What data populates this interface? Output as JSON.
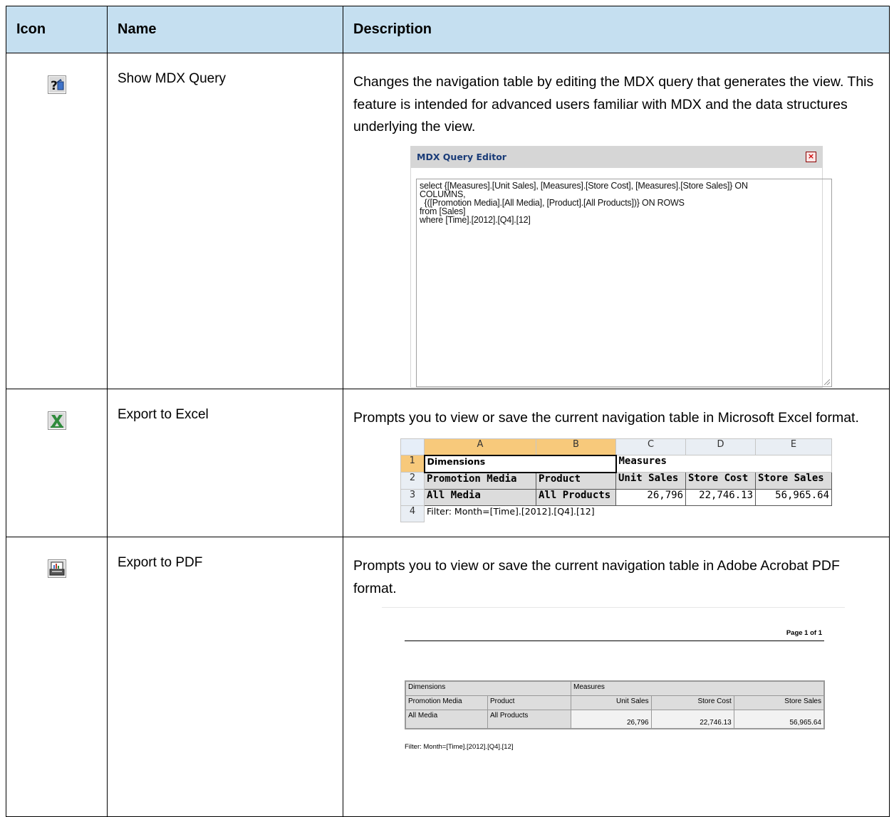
{
  "headers": {
    "icon": "Icon",
    "name": "Name",
    "description": "Description"
  },
  "rows": [
    {
      "icon": "mdx-query-icon",
      "name": "Show MDX Query",
      "description": "Changes the navigation table by editing the MDX query that generates the view. This feature is intended for advanced users familiar with MDX and the data structures underlying the view."
    },
    {
      "icon": "excel-export-icon",
      "name": "Export to Excel",
      "description": "Prompts you to view or save the current navigation table in Microsoft Excel format."
    },
    {
      "icon": "pdf-export-icon",
      "name": "Export to PDF",
      "description": "Prompts you to view or save the current navigation table in Adobe Acrobat PDF format."
    }
  ],
  "mdx_editor": {
    "title": "MDX Query Editor",
    "close_glyph": "×",
    "query": "select {[Measures].[Unit Sales], [Measures].[Store Cost], [Measures].[Store Sales]} ON\nCOLUMNS,\n  {([Promotion Media].[All Media], [Product].[All Products])} ON ROWS\nfrom [Sales]\nwhere [Time].[2012].[Q4].[12]"
  },
  "excel_preview": {
    "columns": [
      "A",
      "B",
      "C",
      "D",
      "E"
    ],
    "row_numbers": [
      "1",
      "2",
      "3",
      "4"
    ],
    "dimensions": "Dimensions",
    "measures": "Measures",
    "headers": [
      "Promotion Media",
      "Product",
      "Unit Sales",
      "Store Cost",
      "Store Sales"
    ],
    "values": [
      "All Media",
      "All Products",
      "26,796",
      "22,746.13",
      "56,965.64"
    ],
    "filter": "Filter: Month=[Time].[2012].[Q4].[12]"
  },
  "pdf_preview": {
    "page": "Page 1 of 1",
    "dimensions": "Dimensions",
    "measures": "Measures",
    "headers": [
      "Promotion Media",
      "Product",
      "Unit Sales",
      "Store Cost",
      "Store Sales"
    ],
    "values": [
      "All Media",
      "All Products",
      "26,796",
      "22,746.13",
      "56,965.64"
    ],
    "filter": "Filter: Month=[Time].[2012].[Q4].[12]"
  }
}
